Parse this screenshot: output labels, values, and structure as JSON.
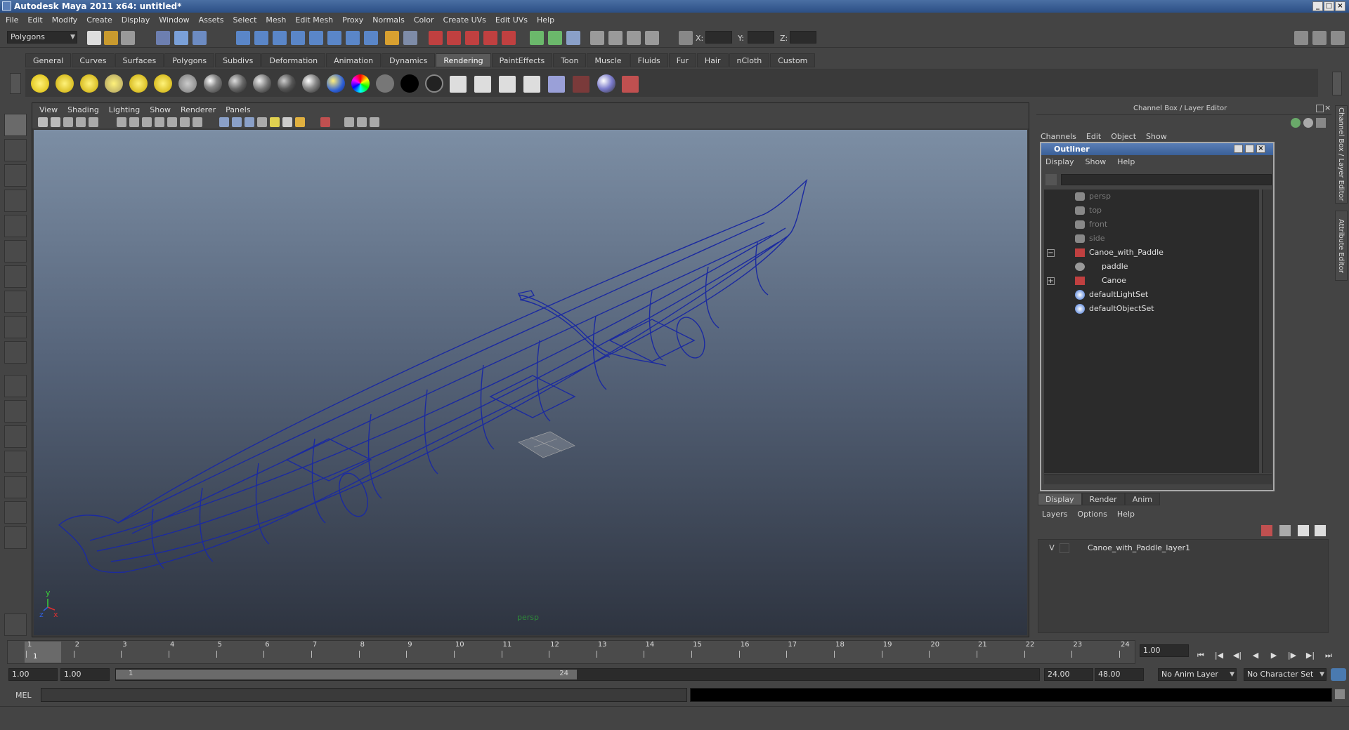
{
  "window": {
    "title": "Autodesk Maya 2011 x64: untitled*"
  },
  "menubar": [
    "File",
    "Edit",
    "Modify",
    "Create",
    "Display",
    "Window",
    "Assets",
    "Select",
    "Mesh",
    "Edit Mesh",
    "Proxy",
    "Normals",
    "Color",
    "Create UVs",
    "Edit UVs",
    "Help"
  ],
  "statusline": {
    "menu_set": "Polygons",
    "x_label": "X:",
    "y_label": "Y:",
    "z_label": "Z:"
  },
  "shelf": {
    "tabs": [
      "General",
      "Curves",
      "Surfaces",
      "Polygons",
      "Subdivs",
      "Deformation",
      "Animation",
      "Dynamics",
      "Rendering",
      "PaintEffects",
      "Toon",
      "Muscle",
      "Fluids",
      "Fur",
      "Hair",
      "nCloth",
      "Custom"
    ],
    "active_tab": "Rendering"
  },
  "viewport": {
    "menu": [
      "View",
      "Shading",
      "Lighting",
      "Show",
      "Renderer",
      "Panels"
    ],
    "camera_label": "persp",
    "axis_y": "y",
    "axis_x": "x",
    "axis_z": "z",
    "wire_color": "#1b2aa0"
  },
  "channelbox": {
    "title": "Channel Box / Layer Editor",
    "menu": [
      "Channels",
      "Edit",
      "Object",
      "Show"
    ],
    "side_tab_1": "Channel Box / Layer Editor",
    "side_tab_2": "Attribute Editor"
  },
  "outliner": {
    "title": "Outliner",
    "menu": [
      "Display",
      "Show",
      "Help"
    ],
    "items": [
      {
        "label": "persp",
        "dim": true
      },
      {
        "label": "top",
        "dim": true
      },
      {
        "label": "front",
        "dim": true
      },
      {
        "label": "side",
        "dim": true
      },
      {
        "label": "Canoe_with_Paddle",
        "dim": false
      },
      {
        "label": "paddle",
        "dim": false
      },
      {
        "label": "Canoe",
        "dim": false
      },
      {
        "label": "defaultLightSet",
        "dim": false
      },
      {
        "label": "defaultObjectSet",
        "dim": false
      }
    ],
    "expand_minus": "−",
    "expand_plus": "+"
  },
  "layereditor": {
    "tabs": [
      "Display",
      "Render",
      "Anim"
    ],
    "menu": [
      "Layers",
      "Options",
      "Help"
    ],
    "layer_visibility": "V",
    "layer_name": "Canoe_with_Paddle_layer1"
  },
  "timeslider": {
    "ticks": [
      "1",
      "2",
      "3",
      "4",
      "5",
      "6",
      "7",
      "8",
      "9",
      "10",
      "11",
      "12",
      "13",
      "14",
      "15",
      "16",
      "17",
      "18",
      "19",
      "20",
      "21",
      "22",
      "23",
      "24"
    ],
    "current_frame_marker": "1",
    "current_time": "1.00"
  },
  "rangeslider": {
    "start_time": "1.00",
    "playback_start": "1.00",
    "range_start_label": "1",
    "range_end_label": "24",
    "playback_end": "24.00",
    "end_time": "48.00",
    "anim_layer": "No Anim Layer",
    "character_set": "No Character Set"
  },
  "cmdline": {
    "label": "MEL"
  }
}
